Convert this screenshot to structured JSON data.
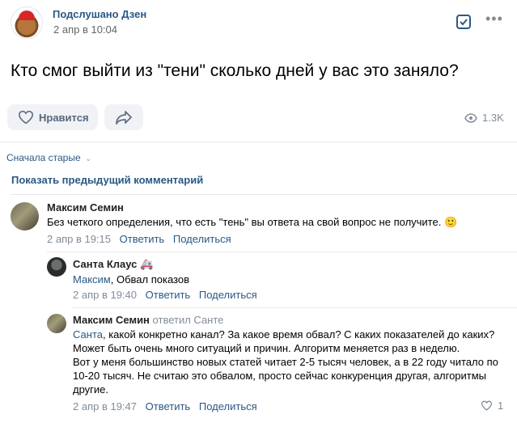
{
  "post": {
    "group_name": "Подслушано Дзен",
    "time": "2 апр в 10:04",
    "text": "Кто смог выйти из \"тени\" сколько дней у вас это заняло?",
    "like_label": "Нравится",
    "views": "1.3K"
  },
  "comments_header": {
    "sort_label": "Сначала старые",
    "show_previous": "Показать предыдущий комментарий"
  },
  "comments": [
    {
      "author": "Максим Семин",
      "text": "Без четкого определения, что есть \"тень\" вы ответа на свой вопрос не получите. 🙂",
      "time": "2 апр в 19:15",
      "reply_label": "Ответить",
      "share_label": "Поделиться"
    },
    {
      "author": "Санта Клаус 🚑",
      "mention": "Максим",
      "text": ", Обвал показов",
      "time": "2 апр в 19:40",
      "reply_label": "Ответить",
      "share_label": "Поделиться"
    },
    {
      "author": "Максим Семин",
      "reply_to": "ответил Санте",
      "mention": "Санта",
      "text_lines": [
        ", какой конкретно канал? За какое время обвал? С каких показателей до каких?",
        "Может быть очень много ситуаций и причин. Алгоритм меняется раз в неделю.",
        "Вот у меня большинство новых статей читает 2-5 тысяч человек, а в 22 году читало по",
        "10-20 тысяч. Не считаю это обвалом, просто сейчас конкуренция другая, алгоритмы",
        "другие."
      ],
      "time": "2 апр в 19:47",
      "reply_label": "Ответить",
      "share_label": "Поделиться",
      "likes": "1"
    }
  ]
}
